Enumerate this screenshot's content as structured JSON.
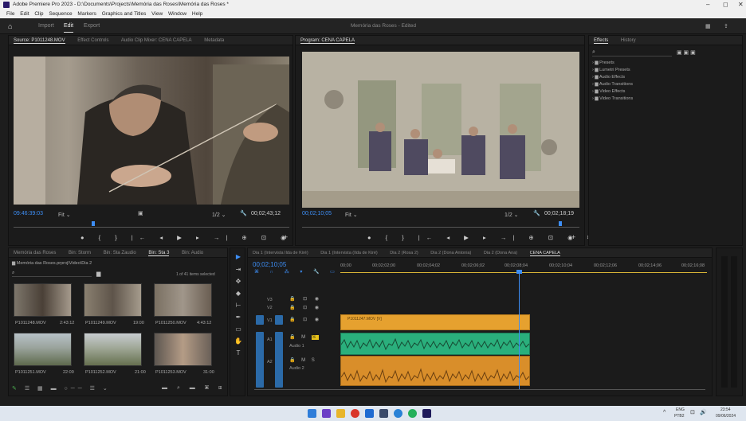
{
  "window": {
    "title": "Adobe Premiere Pro 2023 - D:\\Documents\\Projects\\Memória das Roses\\Memória das Roses *",
    "min": "–",
    "max": "◻",
    "close": "✕"
  },
  "menu": [
    "File",
    "Edit",
    "Clip",
    "Sequence",
    "Markers",
    "Graphics and Titles",
    "View",
    "Window",
    "Help"
  ],
  "workspaces": {
    "import": "Import",
    "edit": "Edit",
    "export": "Export"
  },
  "document_title": "Memória das Roses - Edited",
  "source_panel": {
    "tabs": [
      "Source: P1011248.MOV",
      "Effect Controls",
      "Audio Clip Mixer: CENA CAPELA",
      "Metadata"
    ],
    "timecode": "09:46:39:03",
    "fit": "Fit",
    "ratio": "1/2",
    "duration": "00;02;43;12"
  },
  "program_panel": {
    "tab": "Program: CENA CAPELA",
    "timecode": "00;02;10;05",
    "fit": "Fit",
    "ratio": "1/2",
    "duration": "00;02;18;19"
  },
  "effects_panel": {
    "tabs": [
      "Effects",
      "History"
    ],
    "items": [
      "Presets",
      "Lumetri Presets",
      "Audio Effects",
      "Audio Transitions",
      "Video Effects",
      "Video Transitions"
    ]
  },
  "project_panel": {
    "tabs": [
      "Memória das Roses",
      "Bin: Storm",
      "Bin: Sta Zaudio",
      "Bin: Sta 3",
      "Bin: Audio"
    ],
    "path": "Memória das Roses.prproj\\Video\\Dia 2",
    "count": "1 of 41 items selected",
    "clips": [
      {
        "name": "P1011248.MOV",
        "dur": "2:43:12"
      },
      {
        "name": "P1011249.MOV",
        "dur": "19:00"
      },
      {
        "name": "P1011250.MOV",
        "dur": "4:43:12"
      },
      {
        "name": "P1011251.MOV",
        "dur": "22:09"
      },
      {
        "name": "P1011252.MOV",
        "dur": "21:00"
      },
      {
        "name": "P1011253.MOV",
        "dur": "31:00"
      }
    ]
  },
  "timeline": {
    "tabs": [
      "Dia 1 (Intervista Ilda de Kiré)",
      "Dia 1 (Intervista (Ilda de Kiré)",
      "Dia 2 (Rosa 2)",
      "Dia 2 (Dona Antonia)",
      "Dia 2 (Dona Ana)",
      "CENA CAPELA"
    ],
    "timecode": "00;02;10;05",
    "ruler": [
      "00;00",
      "00;02;02;00",
      "00;02;04;02",
      "00;02;06;02",
      "00;02;08;04",
      "00;02;10;04",
      "00;02;12;06",
      "00;02;14;06",
      "00;02;16;08"
    ],
    "tracks": {
      "v3": "V3",
      "v2": "V2",
      "v1": "V1",
      "a1": "A1",
      "a2": "A2"
    },
    "audio_names": [
      "Audio 1",
      "Audio 2"
    ],
    "video_clip": "P1011247.MOV [V]"
  },
  "taskbar": {
    "lang": "ENG",
    "lang2": "PTB2",
    "time": "23:54",
    "date": "09/06/2024"
  }
}
